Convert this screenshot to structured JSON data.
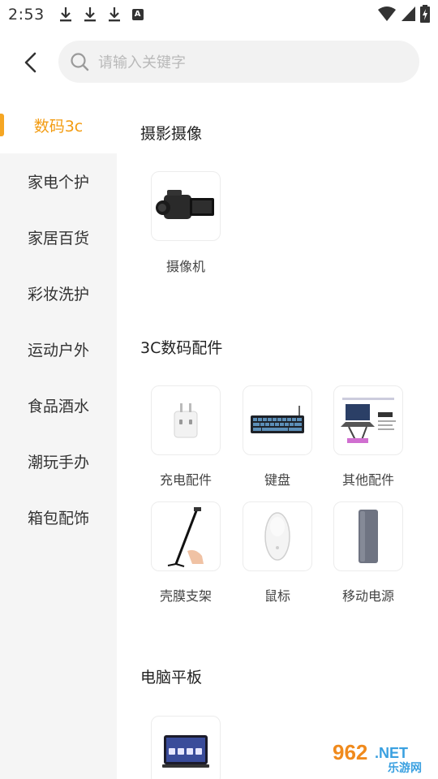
{
  "status_bar": {
    "time": "2:53",
    "notif_letter": "A"
  },
  "search": {
    "placeholder": "请输入关键字"
  },
  "sidebar": {
    "items": [
      {
        "label": "数码3c",
        "active": true
      },
      {
        "label": "家电个护"
      },
      {
        "label": "家居百货"
      },
      {
        "label": "彩妆洗护"
      },
      {
        "label": "运动户外"
      },
      {
        "label": "食品酒水"
      },
      {
        "label": "潮玩手办"
      },
      {
        "label": "箱包配饰"
      }
    ]
  },
  "sections": [
    {
      "title": "摄影摄像",
      "items": [
        {
          "label": "摄像机",
          "icon": "camcorder-icon"
        }
      ]
    },
    {
      "title": "3C数码配件",
      "items": [
        {
          "label": "充电配件",
          "icon": "charger-icon"
        },
        {
          "label": "键盘",
          "icon": "keyboard-icon"
        },
        {
          "label": "其他配件",
          "icon": "laptop-stand-icon"
        },
        {
          "label": "壳膜支架",
          "icon": "selfie-stick-icon"
        },
        {
          "label": "鼠标",
          "icon": "mouse-icon"
        },
        {
          "label": "移动电源",
          "icon": "power-bank-icon"
        }
      ]
    },
    {
      "title": "电脑平板",
      "items": [
        {
          "label": "",
          "icon": "tablet-icon"
        }
      ]
    }
  ],
  "watermark": {
    "number": "962",
    "suffix": ".NET",
    "text": "乐游网"
  },
  "colors": {
    "accent": "#f39c12",
    "sidebar_bg": "#f5f5f5"
  }
}
